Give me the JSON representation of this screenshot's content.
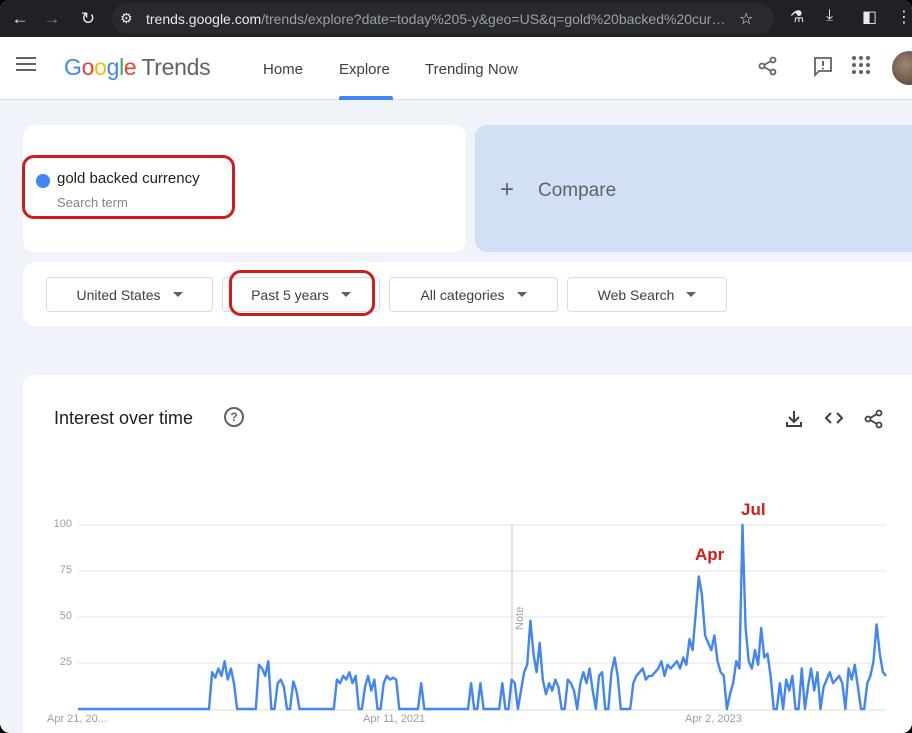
{
  "browser": {
    "url_host": "trends.google.com",
    "url_rest": "/trends/explore?date=today%205-y&geo=US&q=gold%20backed%20cur…"
  },
  "header": {
    "logo_google": "Google",
    "logo_trends": "Trends",
    "nav": [
      "Home",
      "Explore",
      "Trending Now"
    ],
    "active_tab": "Explore"
  },
  "search": {
    "term": "gold backed currency",
    "term_sub": "Search term",
    "term_color": "#4285f4",
    "compare_label": "Compare"
  },
  "filters": {
    "location": "United States",
    "time_range": "Past 5 years",
    "category": "All categories",
    "search_type": "Web Search"
  },
  "chart_card": {
    "title": "Interest over time"
  },
  "annotations": {
    "peak_apr": "Apr",
    "peak_jul": "Jul",
    "color": "#d01c1c"
  },
  "chart_data": {
    "type": "line",
    "title": "Interest over time",
    "series": [
      {
        "name": "gold backed currency",
        "color": "#4285f4"
      }
    ],
    "ylim": [
      0,
      100
    ],
    "y_ticks": [
      "100",
      "75",
      "50",
      "25"
    ],
    "x_ticks": [
      "Apr 21, 20...",
      "Apr 11, 2021",
      "Apr 2, 2023"
    ],
    "note_label": "Note",
    "weeks": 260,
    "values": [
      0,
      0,
      0,
      0,
      0,
      0,
      0,
      0,
      0,
      0,
      0,
      0,
      0,
      0,
      0,
      0,
      0,
      0,
      0,
      0,
      0,
      0,
      0,
      0,
      0,
      0,
      0,
      0,
      0,
      0,
      0,
      0,
      0,
      0,
      0,
      0,
      0,
      0,
      0,
      0,
      0,
      0,
      0,
      0,
      0,
      0,
      0,
      0,
      0,
      0,
      0,
      0,
      0,
      0,
      0,
      0,
      0,
      0,
      0,
      0,
      0,
      0,
      0,
      0,
      0,
      0,
      0,
      0,
      0,
      0,
      0,
      0,
      0,
      0,
      0,
      0,
      0,
      0,
      0,
      0,
      0,
      0,
      0,
      0,
      0,
      0,
      0,
      0,
      0,
      0,
      0,
      0,
      0,
      0,
      0,
      0,
      0,
      0,
      0,
      0,
      0,
      0,
      0,
      0,
      0,
      0,
      0,
      0,
      0,
      0,
      0,
      0,
      0,
      0,
      0,
      0,
      0,
      0,
      0,
      0,
      0,
      0,
      0,
      0,
      0,
      0,
      0,
      0,
      0,
      0,
      0,
      0,
      0,
      0,
      0,
      0,
      0,
      0,
      0,
      0,
      0,
      0,
      0,
      0,
      0,
      0,
      0,
      0,
      0,
      0,
      0,
      0,
      0,
      0,
      0,
      0,
      0,
      0,
      0,
      0,
      0,
      0,
      0,
      0,
      0,
      0,
      0,
      0,
      0,
      0,
      0,
      0,
      0,
      0,
      0,
      0,
      0,
      0,
      0,
      0,
      0,
      0,
      0,
      0,
      0,
      0,
      0,
      0,
      0,
      0,
      0,
      0,
      0,
      0,
      0,
      0,
      0,
      0,
      0,
      0,
      0,
      0,
      0,
      0,
      0,
      0,
      0,
      0,
      0,
      0,
      0,
      0,
      0,
      0,
      0,
      0,
      0,
      0,
      0,
      0,
      0,
      0,
      0,
      0,
      0,
      0,
      0,
      0,
      0,
      0,
      0,
      0,
      0,
      0,
      0,
      0,
      0,
      0,
      0,
      0,
      0,
      0,
      0,
      0,
      0,
      0,
      0,
      0,
      0,
      0,
      0,
      0,
      0,
      0,
      0,
      0,
      0,
      0,
      0,
      0
    ]
  }
}
